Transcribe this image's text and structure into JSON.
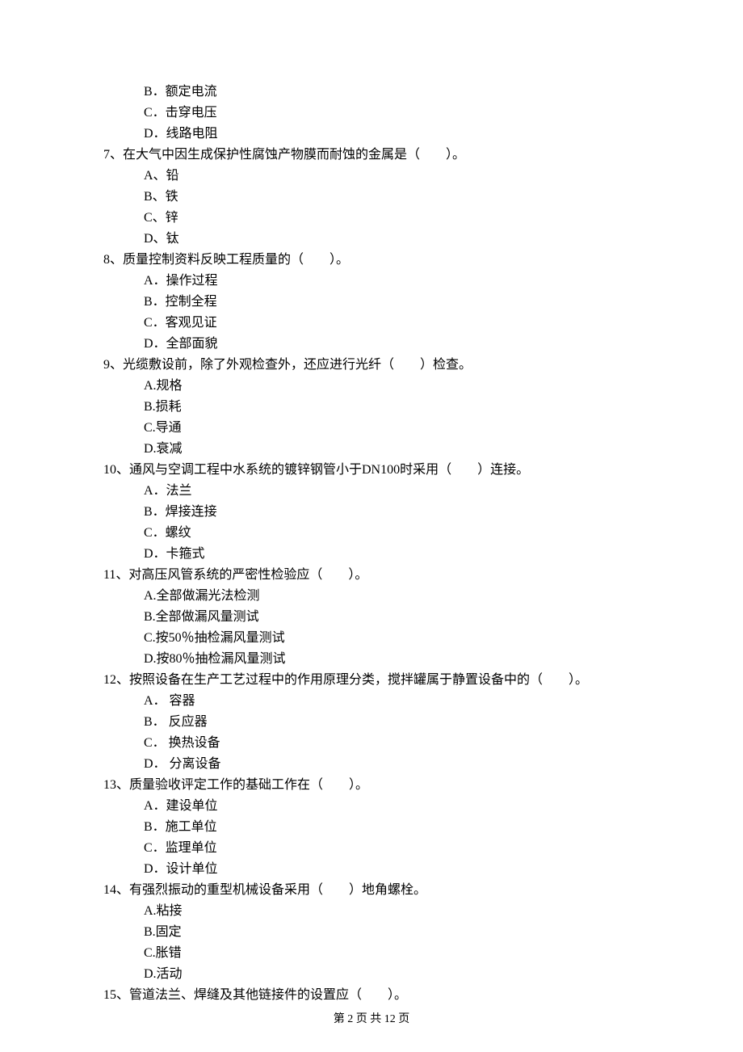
{
  "orphan_options": [
    "B．额定电流",
    "C．击穿电压",
    "D．线路电阻"
  ],
  "questions": [
    {
      "stem": "7、在大气中因生成保护性腐蚀产物膜而耐蚀的金属是（　　）。",
      "options": [
        "A、铅",
        "B、铁",
        "C、锌",
        "D、钛"
      ]
    },
    {
      "stem": "8、质量控制资料反映工程质量的（　　）。",
      "options": [
        "A．操作过程",
        "B．控制全程",
        "C．客观见证",
        "D．全部面貌"
      ]
    },
    {
      "stem": "9、光缆敷设前，除了外观检查外，还应进行光纤（　　）检查。",
      "options": [
        "A.规格",
        "B.损耗",
        "C.导通",
        "D.衰减"
      ]
    },
    {
      "stem": "10、通风与空调工程中水系统的镀锌钢管小于DN100时采用（　　）连接。",
      "options": [
        "A．法兰",
        "B．焊接连接",
        "C．螺纹",
        "D．卡箍式"
      ]
    },
    {
      "stem": "11、对高压风管系统的严密性检验应（　　）。",
      "options": [
        "A.全部做漏光法检测",
        "B.全部做漏风量测试",
        "C.按50％抽检漏风量测试",
        "D.按80％抽检漏风量测试"
      ]
    },
    {
      "stem": "12、按照设备在生产工艺过程中的作用原理分类，搅拌罐属于静置设备中的（　　）。",
      "options": [
        "A． 容器",
        "B． 反应器",
        "C． 换热设备",
        "D． 分离设备"
      ]
    },
    {
      "stem": "13、质量验收评定工作的基础工作在（　　）。",
      "options": [
        "A．建设单位",
        "B．施工单位",
        "C．监理单位",
        "D．设计单位"
      ]
    },
    {
      "stem": "14、有强烈振动的重型机械设备采用（　　）地角螺栓。",
      "options": [
        "A.粘接",
        "B.固定",
        "C.胀错",
        "D.活动"
      ]
    },
    {
      "stem": "15、管道法兰、焊缝及其他链接件的设置应（　　）。",
      "options": []
    }
  ],
  "footer": "第 2 页 共 12 页"
}
